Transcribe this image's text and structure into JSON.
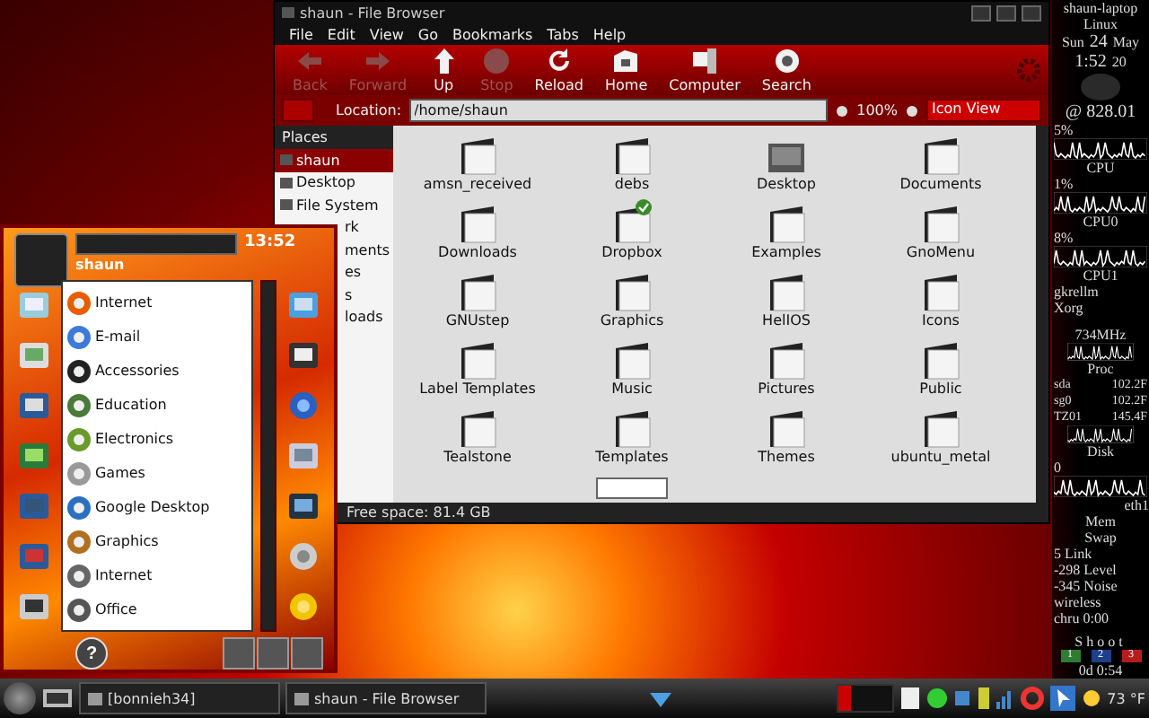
{
  "file_browser": {
    "title": "shaun - File Browser",
    "menu": [
      "File",
      "Edit",
      "View",
      "Go",
      "Bookmarks",
      "Tabs",
      "Help"
    ],
    "toolbar": [
      {
        "kind": "back",
        "label": "Back",
        "disabled": true
      },
      {
        "kind": "forward",
        "label": "Forward",
        "disabled": true
      },
      {
        "kind": "up",
        "label": "Up",
        "disabled": false
      },
      {
        "kind": "stop",
        "label": "Stop",
        "disabled": true
      },
      {
        "kind": "reload",
        "label": "Reload",
        "disabled": false
      },
      {
        "kind": "home",
        "label": "Home",
        "disabled": false
      },
      {
        "kind": "computer",
        "label": "Computer",
        "disabled": false
      },
      {
        "kind": "search",
        "label": "Search",
        "disabled": false
      }
    ],
    "location_label": "Location:",
    "location": "/home/shaun",
    "zoom": "100%",
    "view": "Icon View",
    "places_header": "Places",
    "places": [
      {
        "label": "shaun",
        "kind": "full",
        "selected": true
      },
      {
        "label": "Desktop",
        "kind": "full",
        "selected": false
      },
      {
        "label": "File System",
        "kind": "full",
        "selected": false
      },
      {
        "label": "rk",
        "kind": "partial",
        "selected": false
      },
      {
        "label": "ments",
        "kind": "partial",
        "selected": false
      },
      {
        "label": "es",
        "kind": "partial",
        "selected": false
      },
      {
        "label": "s",
        "kind": "partial",
        "selected": false
      },
      {
        "label": "loads",
        "kind": "partial",
        "selected": false
      }
    ],
    "files": [
      {
        "name": "amsn_received",
        "kind": "folder",
        "synced": false
      },
      {
        "name": "debs",
        "kind": "folder",
        "synced": false
      },
      {
        "name": "Desktop",
        "kind": "desktop",
        "synced": false
      },
      {
        "name": "Documents",
        "kind": "folder",
        "synced": false
      },
      {
        "name": "Downloads",
        "kind": "folder",
        "synced": false
      },
      {
        "name": "Dropbox",
        "kind": "folder",
        "synced": true
      },
      {
        "name": "Examples",
        "kind": "folder",
        "synced": false
      },
      {
        "name": "GnoMenu",
        "kind": "folder",
        "synced": false
      },
      {
        "name": "GNUstep",
        "kind": "folder",
        "synced": false
      },
      {
        "name": "Graphics",
        "kind": "folder",
        "synced": false
      },
      {
        "name": "HelIOS",
        "kind": "folder",
        "synced": false
      },
      {
        "name": "Icons",
        "kind": "folder",
        "synced": false
      },
      {
        "name": "Label Templates",
        "kind": "folder",
        "synced": false
      },
      {
        "name": "Music",
        "kind": "folder",
        "synced": false
      },
      {
        "name": "Pictures",
        "kind": "folder",
        "synced": false
      },
      {
        "name": "Public",
        "kind": "folder",
        "synced": false
      },
      {
        "name": "Tealstone",
        "kind": "folder",
        "synced": false
      },
      {
        "name": "Templates",
        "kind": "folder",
        "synced": false
      },
      {
        "name": "Themes",
        "kind": "folder",
        "synced": false
      },
      {
        "name": "ubuntu_metal",
        "kind": "folder",
        "synced": false
      }
    ],
    "status": "Free space: 81.4 GB"
  },
  "app_menu": {
    "time": "13:52",
    "user": "shaun",
    "items": [
      "Internet",
      "E-mail",
      "Accessories",
      "Education",
      "Electronics",
      "Games",
      "Google Desktop",
      "Graphics",
      "Internet",
      "Office"
    ],
    "help": "?"
  },
  "conky": {
    "host": "shaun-laptop",
    "os": "Linux",
    "weekday": "Sun",
    "day": "24",
    "month": "May",
    "time": "1:52",
    "seconds": "20",
    "total": "@ 828.01",
    "cpus": [
      {
        "percent": "5%",
        "label": "CPU"
      },
      {
        "percent": "1%",
        "label": "CPU0"
      },
      {
        "percent": "8%",
        "label": "CPU1"
      }
    ],
    "processes": [
      "gkrellm",
      "Xorg"
    ],
    "freq": "734MHz",
    "proc_label": "Proc",
    "temps": [
      {
        "name": "sda",
        "value": "102.2F"
      },
      {
        "name": "sg0",
        "value": "102.2F"
      },
      {
        "name": "TZ01",
        "value": "145.4F"
      }
    ],
    "disk_label": "Disk",
    "disk_value": "0",
    "iface": "eth1",
    "mem_label": "Mem",
    "swap_label": "Swap",
    "wireless": [
      "5 Link",
      "-298 Level",
      "-345 Noise",
      "wireless",
      "chru 0:00"
    ],
    "shoot": "Shoot",
    "workspaces": [
      {
        "label": "1",
        "color": "#2e7d32"
      },
      {
        "label": "2",
        "color": "#1e3f8a"
      },
      {
        "label": "3",
        "color": "#b71c1c"
      }
    ],
    "uptime": "0d 0:54"
  },
  "taskbar": {
    "tasks": [
      "[bonnieh34]",
      "shaun - File Browser"
    ],
    "weather": "73 °F"
  }
}
